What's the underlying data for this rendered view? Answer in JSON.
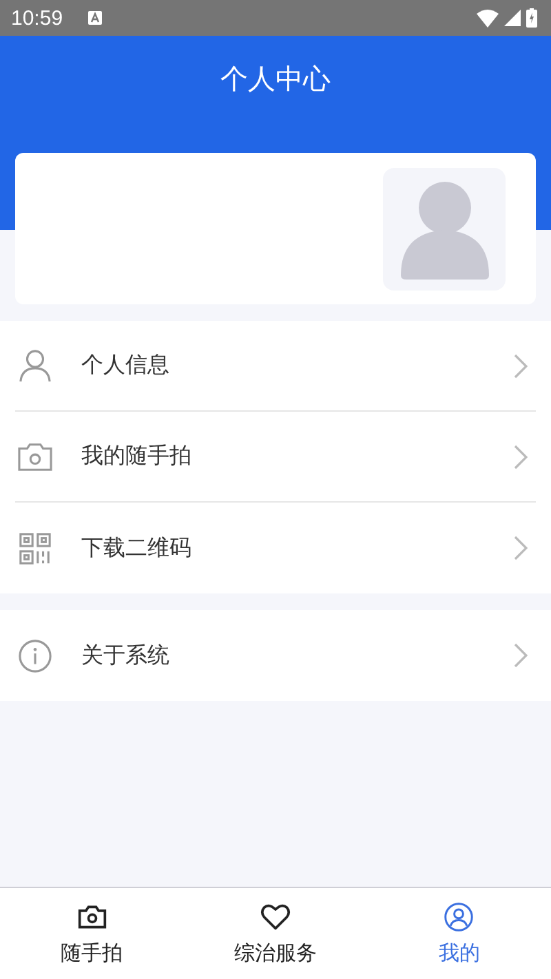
{
  "status_bar": {
    "time": "10:59"
  },
  "header": {
    "title": "个人中心"
  },
  "menu_groups": [
    {
      "items": [
        {
          "label": "个人信息",
          "kind": "person"
        },
        {
          "label": "我的随手拍",
          "kind": "camera"
        },
        {
          "label": "下载二维码",
          "kind": "qr"
        }
      ]
    },
    {
      "items": [
        {
          "label": "关于系统",
          "kind": "info"
        }
      ]
    }
  ],
  "tabs": [
    {
      "label": "随手拍",
      "kind": "camera",
      "selected": false
    },
    {
      "label": "综治服务",
      "kind": "heart",
      "selected": false
    },
    {
      "label": "我的",
      "kind": "user",
      "selected": true
    }
  ]
}
